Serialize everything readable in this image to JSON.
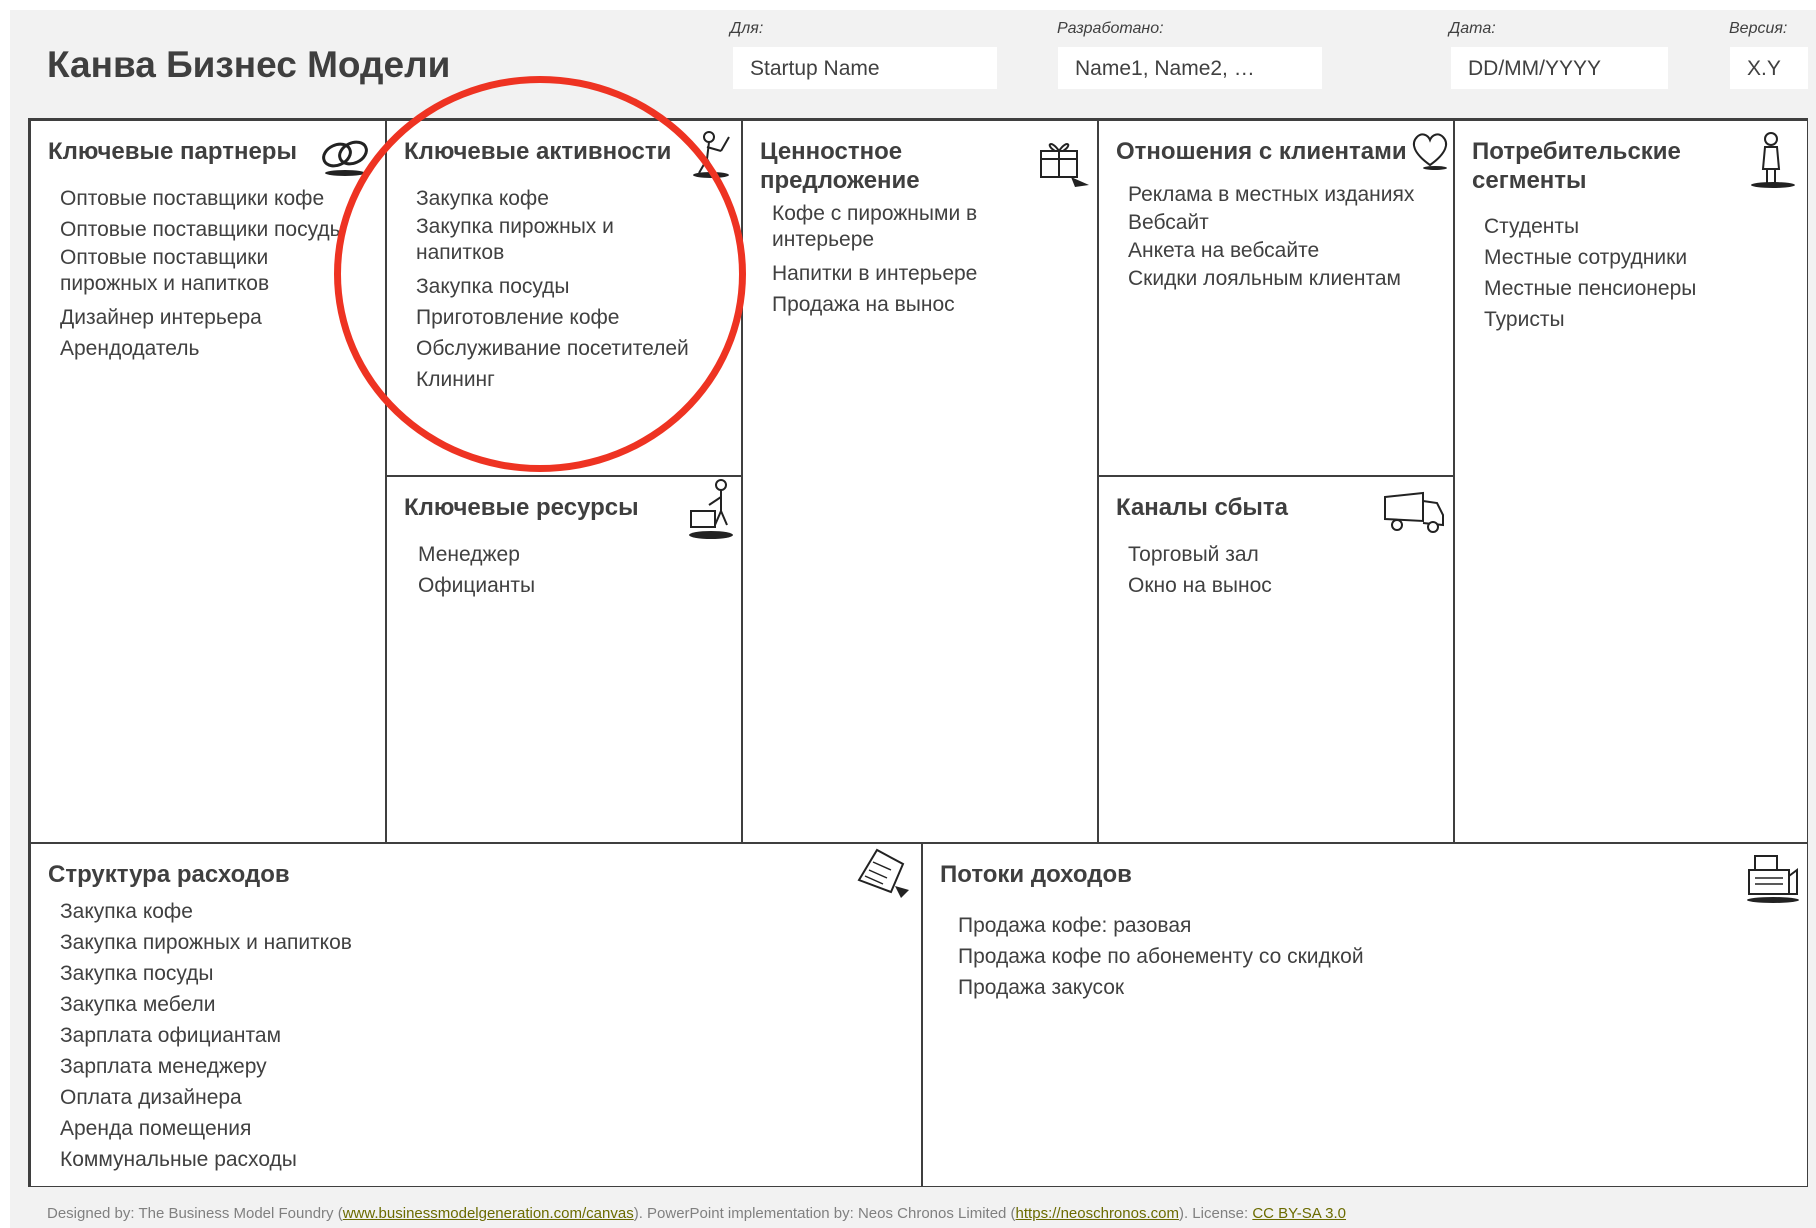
{
  "header": {
    "title": "Канва Бизнес Модели",
    "for_label": "Для:",
    "for_value": "Startup Name",
    "designed_by_label": "Разработано:",
    "designed_by_value": "Name1, Name2, …",
    "date_label": "Дата:",
    "date_value": "DD/MM/YYYY",
    "version_label": "Версия:",
    "version_value": "X.Y"
  },
  "blocks": {
    "partners": {
      "title": "Ключевые партнеры",
      "icon": "chain-links-icon",
      "items": [
        "Оптовые поставщики кофе",
        "Оптовые поставщики посуды",
        "Оптовые поставщики пирожных и напитков",
        "Дизайнер интерьера",
        "Арендодатель"
      ]
    },
    "activities": {
      "title": "Ключевые активности",
      "icon": "worker-icon",
      "items": [
        "Закупка кофе",
        "Закупка пирожных и напитков",
        "Закупка посуды",
        "Приготовление кофе",
        "Обслуживание посетителей",
        "Клининг"
      ]
    },
    "resources": {
      "title": "Ключевые ресурсы",
      "icon": "factory-worker-icon",
      "items": [
        "Менеджер",
        "Официанты"
      ]
    },
    "value": {
      "title": "Ценностное предложение",
      "icon": "gift-icon",
      "items": [
        "Кофе с пирожными в интерьере",
        "Напитки в интерьере",
        "Продажа на вынос"
      ]
    },
    "relationships": {
      "title": "Отношения с клиентами",
      "icon": "heart-icon",
      "items": [
        "Реклама в местных изданиях",
        "Вебсайт",
        "Анкета на вебсайте",
        "Скидки лояльным клиентам"
      ]
    },
    "channels": {
      "title": "Каналы сбыта",
      "icon": "truck-icon",
      "items": [
        "Торговый зал",
        "Окно на вынос"
      ]
    },
    "segments": {
      "title": "Потребительские сегменты",
      "icon": "person-icon",
      "items": [
        "Студенты",
        "Местные сотрудники",
        "Местные пенсионеры",
        "Туристы"
      ]
    },
    "costs": {
      "title": "Структура расходов",
      "icon": "price-tag-icon",
      "items": [
        "Закупка кофе",
        "Закупка пирожных и напитков",
        "Закупка посуды",
        "Закупка мебели",
        "Зарплата официантам",
        "Зарплата менеджеру",
        "Оплата дизайнера",
        "Аренда помещения",
        "Коммунальные расходы"
      ]
    },
    "revenue": {
      "title": "Потоки доходов",
      "icon": "cash-register-icon",
      "items": [
        "Продажа кофе: разовая",
        "Продажа кофе по абонементу со скидкой",
        "Продажа закусок"
      ]
    }
  },
  "footer": {
    "designed_by": "Designed by: The Business Model Foundry (",
    "link1": "www.businessmodelgeneration.com/canvas",
    "mid": "). PowerPoint implementation by: Neos Chronos Limited (",
    "link2": "https://neoschronos.com",
    "license_prefix": "). License: ",
    "license": "CC BY-SA 3.0"
  },
  "colors": {
    "annotation": "#ee3322",
    "border": "#3f3f3f",
    "background": "#f2f2f2"
  }
}
